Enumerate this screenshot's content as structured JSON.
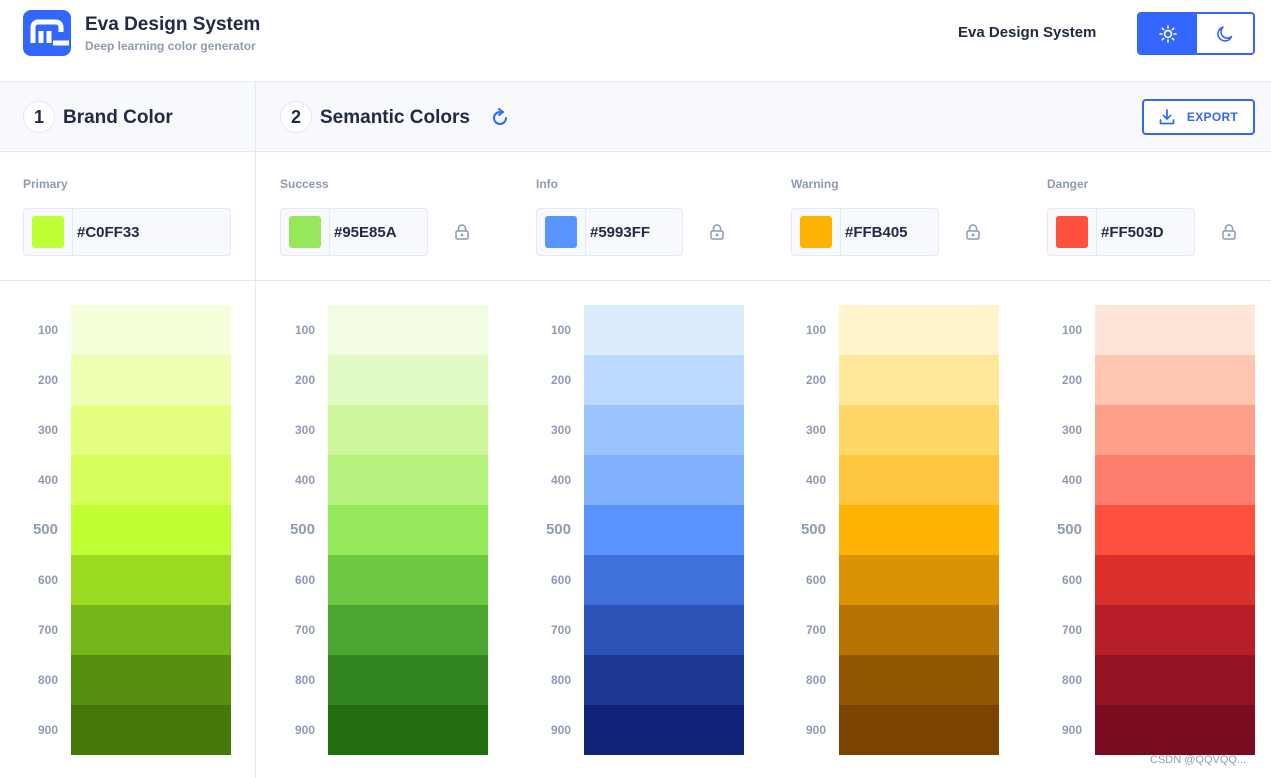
{
  "header": {
    "brand_title": "Eva Design System",
    "brand_subtitle": "Deep learning color generator",
    "nav_title": "Eva Design System",
    "theme_toggle": {
      "active": "light",
      "icons": [
        "sun-icon",
        "moon-icon"
      ]
    }
  },
  "steps": {
    "brand": {
      "number": "1",
      "label": "Brand Color"
    },
    "semantic": {
      "number": "2",
      "label": "Semantic Colors"
    },
    "refresh_icon": "refresh-icon",
    "export_label": "EXPORT",
    "export_icon": "download-icon"
  },
  "accent_color": "#3366FF",
  "palettes": [
    {
      "id": "primary",
      "label": "Primary",
      "value": "#C0FF33",
      "swatch": "#C0FF33",
      "lockable": false,
      "shades": [
        {
          "label": "100",
          "color": "#F5FFDA"
        },
        {
          "label": "200",
          "color": "#EEFFB3"
        },
        {
          "label": "300",
          "color": "#E5FF80"
        },
        {
          "label": "400",
          "color": "#D6FF5C"
        },
        {
          "label": "500",
          "color": "#C0FF33"
        },
        {
          "label": "600",
          "color": "#9ADB22"
        },
        {
          "label": "700",
          "color": "#75B619"
        },
        {
          "label": "800",
          "color": "#55910F"
        },
        {
          "label": "900",
          "color": "#457809"
        }
      ]
    },
    {
      "id": "success",
      "label": "Success",
      "value": "#95E85A",
      "swatch": "#95E85A",
      "lockable": true,
      "shades": [
        {
          "label": "100",
          "color": "#F2FCE0"
        },
        {
          "label": "200",
          "color": "#E2FAC3"
        },
        {
          "label": "300",
          "color": "#CDF79B"
        },
        {
          "label": "400",
          "color": "#B5F27D"
        },
        {
          "label": "500",
          "color": "#95E85A"
        },
        {
          "label": "600",
          "color": "#6EC842"
        },
        {
          "label": "700",
          "color": "#4BA530"
        },
        {
          "label": "800",
          "color": "#33851F"
        },
        {
          "label": "900",
          "color": "#216D10"
        }
      ]
    },
    {
      "id": "info",
      "label": "Info",
      "value": "#5993FF",
      "swatch": "#5993FF",
      "lockable": true,
      "shades": [
        {
          "label": "100",
          "color": "#DDEBFF"
        },
        {
          "label": "200",
          "color": "#BCD9FF"
        },
        {
          "label": "300",
          "color": "#9BC4FF"
        },
        {
          "label": "400",
          "color": "#81B0FF"
        },
        {
          "label": "500",
          "color": "#5993FF"
        },
        {
          "label": "600",
          "color": "#4171DB"
        },
        {
          "label": "700",
          "color": "#2C53B7"
        },
        {
          "label": "800",
          "color": "#1C3893"
        },
        {
          "label": "900",
          "color": "#11227A"
        }
      ]
    },
    {
      "id": "warning",
      "label": "Warning",
      "value": "#FFB405",
      "swatch": "#FFB405",
      "lockable": true,
      "shades": [
        {
          "label": "100",
          "color": "#FFF4CC"
        },
        {
          "label": "200",
          "color": "#FFE799"
        },
        {
          "label": "300",
          "color": "#FFD766"
        },
        {
          "label": "400",
          "color": "#FFC73F"
        },
        {
          "label": "500",
          "color": "#FFB405"
        },
        {
          "label": "600",
          "color": "#DB9203"
        },
        {
          "label": "700",
          "color": "#B77302"
        },
        {
          "label": "800",
          "color": "#935701"
        },
        {
          "label": "900",
          "color": "#7A4300"
        }
      ]
    },
    {
      "id": "danger",
      "label": "Danger",
      "value": "#FF503D",
      "swatch": "#FF503D",
      "lockable": true,
      "shades": [
        {
          "label": "100",
          "color": "#FFE5D8"
        },
        {
          "label": "200",
          "color": "#FFC6B1"
        },
        {
          "label": "300",
          "color": "#FFA18A"
        },
        {
          "label": "400",
          "color": "#FF7E6D"
        },
        {
          "label": "500",
          "color": "#FF503D"
        },
        {
          "label": "600",
          "color": "#DB302C"
        },
        {
          "label": "700",
          "color": "#B71E27"
        },
        {
          "label": "800",
          "color": "#931323"
        },
        {
          "label": "900",
          "color": "#7A0B21"
        }
      ]
    }
  ],
  "watermark": "CSDN @QQVQQ..."
}
